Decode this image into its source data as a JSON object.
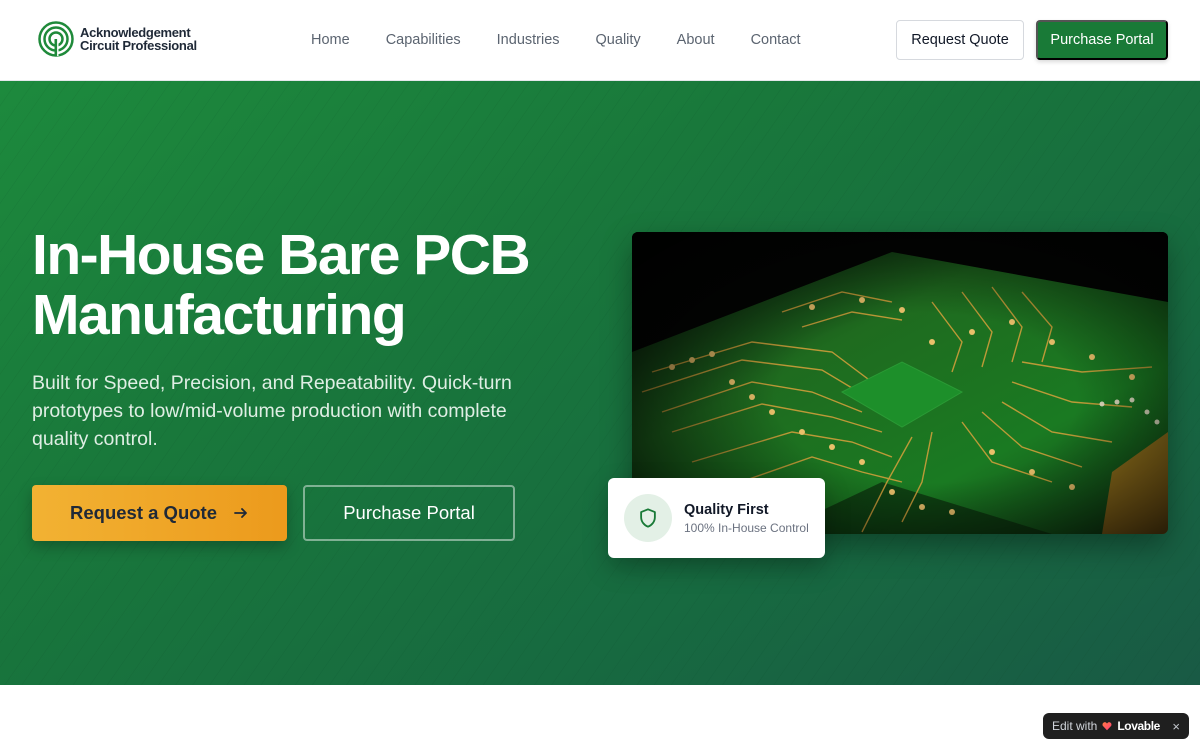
{
  "header": {
    "logo": {
      "line1": "Acknowledgement",
      "line2": "Circuit Professional"
    },
    "nav": [
      {
        "label": "Home"
      },
      {
        "label": "Capabilities"
      },
      {
        "label": "Industries"
      },
      {
        "label": "Quality"
      },
      {
        "label": "About"
      },
      {
        "label": "Contact"
      }
    ],
    "request_quote_label": "Request Quote",
    "purchase_portal_label": "Purchase Portal"
  },
  "hero": {
    "title": "In-House Bare PCB Manufacturing",
    "subtitle": "Built for Speed, Precision, and Repeatability. Quick-turn prototypes to low/mid-volume production with complete quality control.",
    "primary_cta": "Request a Quote",
    "secondary_cta": "Purchase Portal",
    "image_icon": "pcb-circuit-board-image",
    "card": {
      "title": "Quality First",
      "subtitle": "100% In-House Control",
      "icon": "shield-icon"
    }
  },
  "badge": {
    "edit_label": "Edit with",
    "brand": "Lovable",
    "close": "×"
  },
  "colors": {
    "brand_green": "#197a37",
    "hero_green": "#1a7a3c",
    "accent_amber": "#f0a52a",
    "text_dark": "#111827"
  }
}
